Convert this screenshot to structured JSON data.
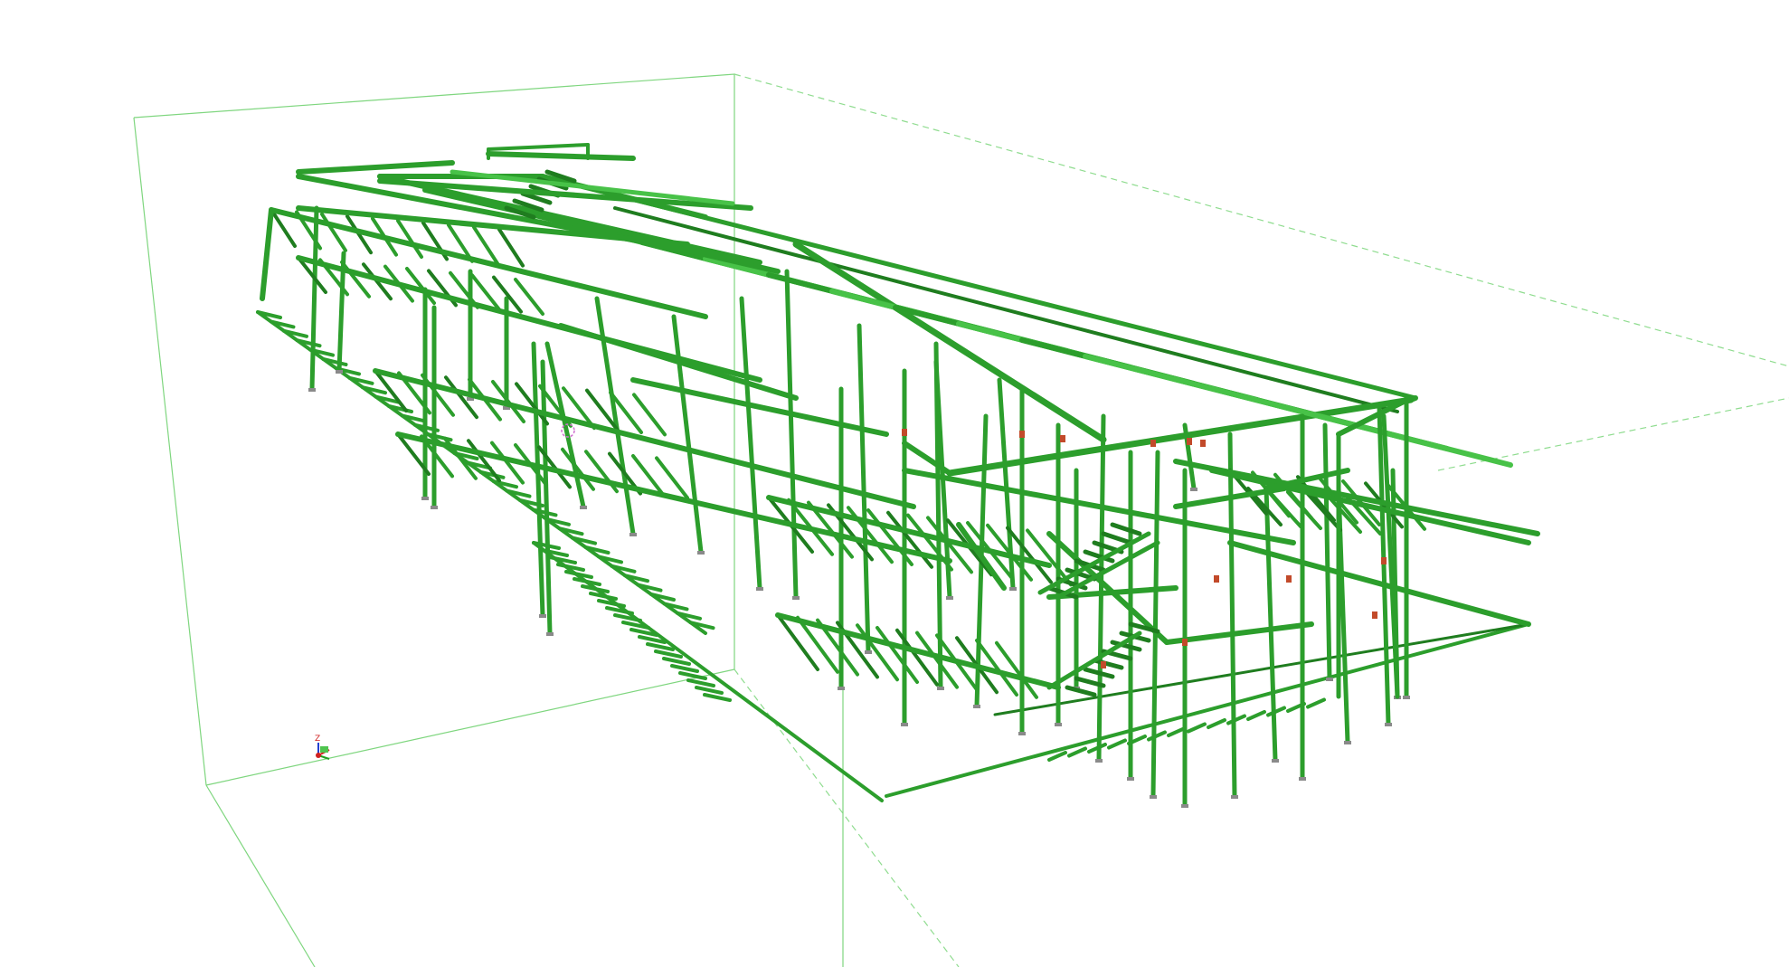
{
  "viewport": {
    "background": "#ffffff",
    "model_color": "#2c9e2c",
    "bounding_box_color": "#7fd67f",
    "view": "3d-isometric",
    "subject": "steel-frame-structure"
  },
  "axis_gizmo": {
    "label": "Z",
    "x_color": "#d02020",
    "y_color": "#20a020",
    "z_color": "#2040d0"
  },
  "selection_marker": {
    "color": "#d070d0"
  }
}
